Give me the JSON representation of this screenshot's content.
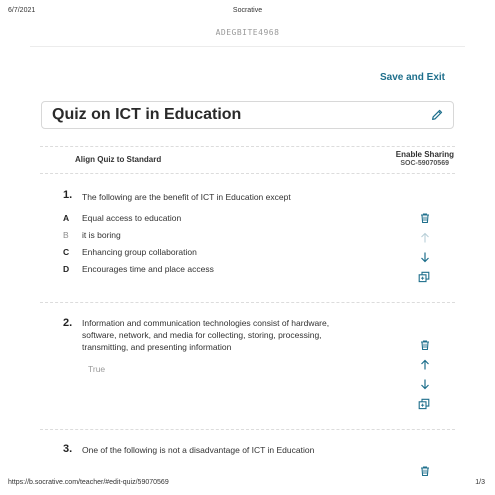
{
  "print_header": {
    "date": "6/7/2021",
    "title": "Socrative"
  },
  "watermark": "ADEGBITE4968",
  "toolbar": {
    "save_exit_label": "Save and Exit"
  },
  "quiz": {
    "title": "Quiz on ICT in Education"
  },
  "settings": {
    "align_label": "Align Quiz to Standard",
    "sharing_label": "Enable Sharing",
    "soc_code": "SOC-59070569"
  },
  "questions": [
    {
      "number": "1.",
      "text": "The following are the benefit of ICT in Education except",
      "options": [
        {
          "letter": "A",
          "text": "Equal access to education"
        },
        {
          "letter": "B",
          "text": "it is boring"
        },
        {
          "letter": "C",
          "text": "Enhancing group collaboration"
        },
        {
          "letter": "D",
          "text": "Encourages time and place access"
        }
      ]
    },
    {
      "number": "2.",
      "text_lines": [
        "Information and communication technologies consist of hardware,",
        "software, network, and media for collecting, storing, processing,",
        "transmitting, and presenting information"
      ],
      "answer": "True"
    },
    {
      "number": "3.",
      "text": "One of the following is not a disadvantage of ICT in Education"
    }
  ],
  "footer": {
    "url": "https://b.socrative.com/teacher/#edit-quiz/59070569",
    "page": "1/3"
  },
  "colors": {
    "accent": "#1e6f8c",
    "disabled": "#b9cfd8"
  }
}
